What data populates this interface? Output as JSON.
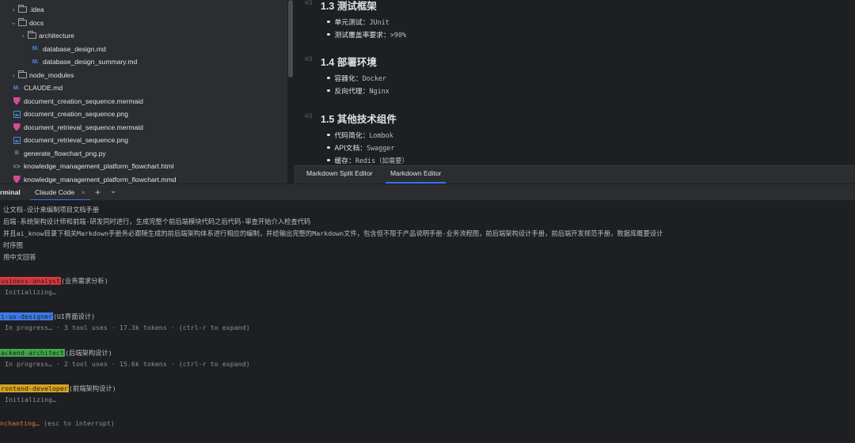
{
  "project_tree": {
    "items": [
      {
        "chevron": "›",
        "icon": "folder-icon",
        "label": ".idea"
      },
      {
        "chevron": "⌄",
        "icon": "folder-icon",
        "label": "docs"
      },
      {
        "chevron": "›",
        "icon": "folder-icon",
        "label": "architecture"
      },
      {
        "chevron": "",
        "icon": "markdown-icon",
        "label": "database_design.md"
      },
      {
        "chevron": "",
        "icon": "markdown-icon",
        "label": "database_design_summary.md"
      },
      {
        "chevron": "›",
        "icon": "folder-icon",
        "label": "node_modules"
      },
      {
        "chevron": "",
        "icon": "markdown-icon",
        "label": "CLAUDE.md"
      },
      {
        "chevron": "",
        "icon": "mermaid-icon",
        "label": "document_creation_sequence.mermaid"
      },
      {
        "chevron": "",
        "icon": "image-icon",
        "label": "document_creation_sequence.png"
      },
      {
        "chevron": "",
        "icon": "mermaid-icon",
        "label": "document_retrieval_sequence.mermaid"
      },
      {
        "chevron": "",
        "icon": "image-icon",
        "label": "document_retrieval_sequence.png"
      },
      {
        "chevron": "",
        "icon": "python-file-icon",
        "label": "generate_flowchart_png.py"
      },
      {
        "chevron": "",
        "icon": "html-file-icon",
        "label": "knowledge_management_platform_flowchart.html"
      },
      {
        "chevron": "",
        "icon": "mermaid-icon",
        "label": "knowledge_management_platform_flowchart.mmd"
      }
    ],
    "markdown_glyph": "M↓"
  },
  "preview": {
    "heading_tag": "H3",
    "sections": [
      {
        "title": "1.3  测试框架",
        "items": [
          {
            "label": "单元测试：",
            "value": "JUnit"
          },
          {
            "label": "测试覆盖率要求：",
            "value": ">90%"
          }
        ]
      },
      {
        "title": "1.4  部署环境",
        "items": [
          {
            "label": "容器化：",
            "value": "Docker"
          },
          {
            "label": "反向代理：",
            "value": "Nginx"
          }
        ]
      },
      {
        "title": "1.5  其他技术组件",
        "items": [
          {
            "label": "代码简化：",
            "value": "Lombok"
          },
          {
            "label": "API文档：",
            "value": "Swagger"
          },
          {
            "label": "缓存：",
            "value": "Redis（如需要）"
          }
        ]
      }
    ]
  },
  "editor_tabs": {
    "split": "Markdown Split Editor",
    "editor": "Markdown Editor"
  },
  "terminal": {
    "tool_window_title": "rminal",
    "tab_label": "Claude Code",
    "close_glyph": "×",
    "add_glyph": "+",
    "dropdown_glyph": "⌄",
    "prompt_lines": [
      "让文档-设计来编制项目文档手册",
      "后端-系统架构设计师和前端-研发同时进行，生成完整个前后端模块代码之后代码-审查开始介入检查代码",
      "并且ai_know目录下相关Markdown手册务必跟随生成的前后端架构体系进行相应的编制，并给输出完整的Markdown文件，包含但不限于产品说明手册-业务流程图，前后端架构设计手册，前后端开发规范手册，数据库概要设计",
      "时序图",
      "用中文回答"
    ],
    "agents": [
      {
        "name": "usiness-analyst",
        "desc": "(业务需求分析)",
        "status": "  Initializing…",
        "color": "red"
      },
      {
        "name": "i-ux-designer",
        "desc": "(UI界面设计)",
        "status": "  In progress… · 3 tool uses · 17.3k tokens · (ctrl-r to expand)",
        "color": "blue"
      },
      {
        "name": "ackend-architect",
        "desc": "(后端架构设计)",
        "status": "  In progress… · 2 tool uses · 15.6k tokens · (ctrl-r to expand)",
        "color": "green"
      },
      {
        "name": "rontend-developer",
        "desc": "(前端架构设计)",
        "status": "  Initializing…",
        "color": "yellow"
      }
    ],
    "spinner_label": "nchanting…",
    "spinner_hint": " (esc to interrupt)"
  },
  "colors": {
    "accent": "#3574f0",
    "badge_red": "#d9383f",
    "badge_blue": "#3d7be6",
    "badge_green": "#3ea84a",
    "badge_yellow": "#d9a321",
    "spinner": "#e0763c"
  }
}
